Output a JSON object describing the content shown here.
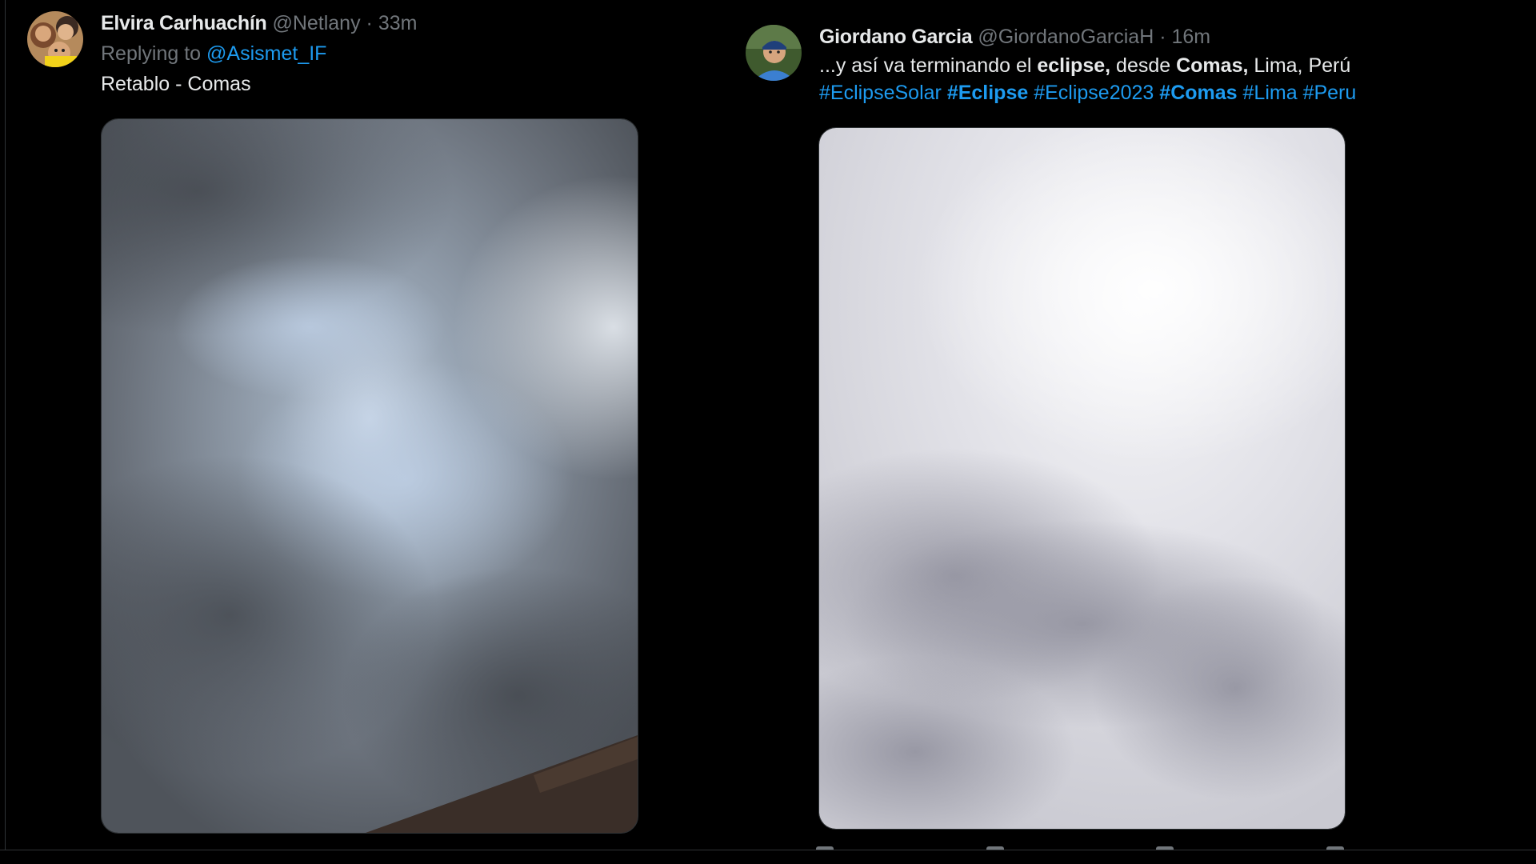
{
  "tweets": [
    {
      "display_name": "Elvira Carhuachín",
      "handle": "@Netlany",
      "time": "33m",
      "replying_prefix": "Replying to",
      "replying_to": "@Asismet_IF",
      "text": "Retablo - Comas"
    },
    {
      "display_name": "Giordano Garcia",
      "handle": "@GiordanoGarciaH",
      "time": "16m",
      "text_parts": [
        "...y así va terminando el ",
        "eclipse,",
        " desde ",
        "Comas,",
        " Lima, Perú"
      ],
      "hashtags": [
        {
          "label": "#EclipseSolar",
          "bold": false
        },
        {
          "label": "#Eclipse",
          "bold": true
        },
        {
          "label": "#Eclipse2023",
          "bold": false
        },
        {
          "label": "#Comas",
          "bold": true
        },
        {
          "label": "#Lima",
          "bold": false
        },
        {
          "label": "#Peru",
          "bold": false
        }
      ]
    }
  ],
  "separator": "·",
  "colors": {
    "background": "#000000",
    "text": "#e7e9ea",
    "muted": "#71767b",
    "link": "#1d9bf0",
    "border": "#2f3336"
  }
}
